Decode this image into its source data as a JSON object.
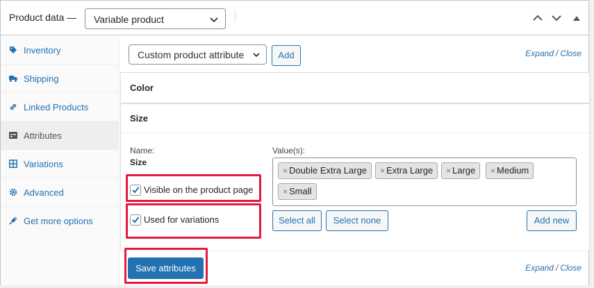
{
  "header": {
    "title": "Product data —",
    "product_type": "Variable product",
    "controls": [
      "chevron-up-icon",
      "chevron-down-icon",
      "collapse-triangle-icon"
    ]
  },
  "sidebar": {
    "items": [
      {
        "label": "Inventory",
        "icon": "tag-icon",
        "active": false
      },
      {
        "label": "Shipping",
        "icon": "truck-icon",
        "active": false
      },
      {
        "label": "Linked Products",
        "icon": "link-icon",
        "active": false
      },
      {
        "label": "Attributes",
        "icon": "list-icon",
        "active": true
      },
      {
        "label": "Variations",
        "icon": "grid-icon",
        "active": false
      },
      {
        "label": "Advanced",
        "icon": "gear-icon",
        "active": false
      },
      {
        "label": "Get more options",
        "icon": "plugin-icon",
        "active": false
      }
    ]
  },
  "toolbar": {
    "attribute_select": "Custom product attribute",
    "add_label": "Add",
    "expand": "Expand",
    "separator": "/",
    "close": "Close"
  },
  "attributes": [
    {
      "name": "Color"
    },
    {
      "name": "Size",
      "name_label": "Name:",
      "name_value": "Size",
      "values_label": "Value(s):",
      "values": [
        "Double Extra Large",
        "Extra Large",
        "Large",
        "Medium",
        "Small"
      ],
      "visible_label": "Visible on the product page",
      "visible_checked": true,
      "variations_label": "Used for variations",
      "variations_checked": true,
      "select_all_label": "Select all",
      "select_none_label": "Select none",
      "add_new_label": "Add new"
    }
  ],
  "footer": {
    "save_label": "Save attributes",
    "expand": "Expand",
    "separator": "/",
    "close": "Close"
  },
  "colors": {
    "accent": "#2271b1",
    "highlight": "#e21a3c",
    "active_tab_bg": "#eeeeee"
  }
}
